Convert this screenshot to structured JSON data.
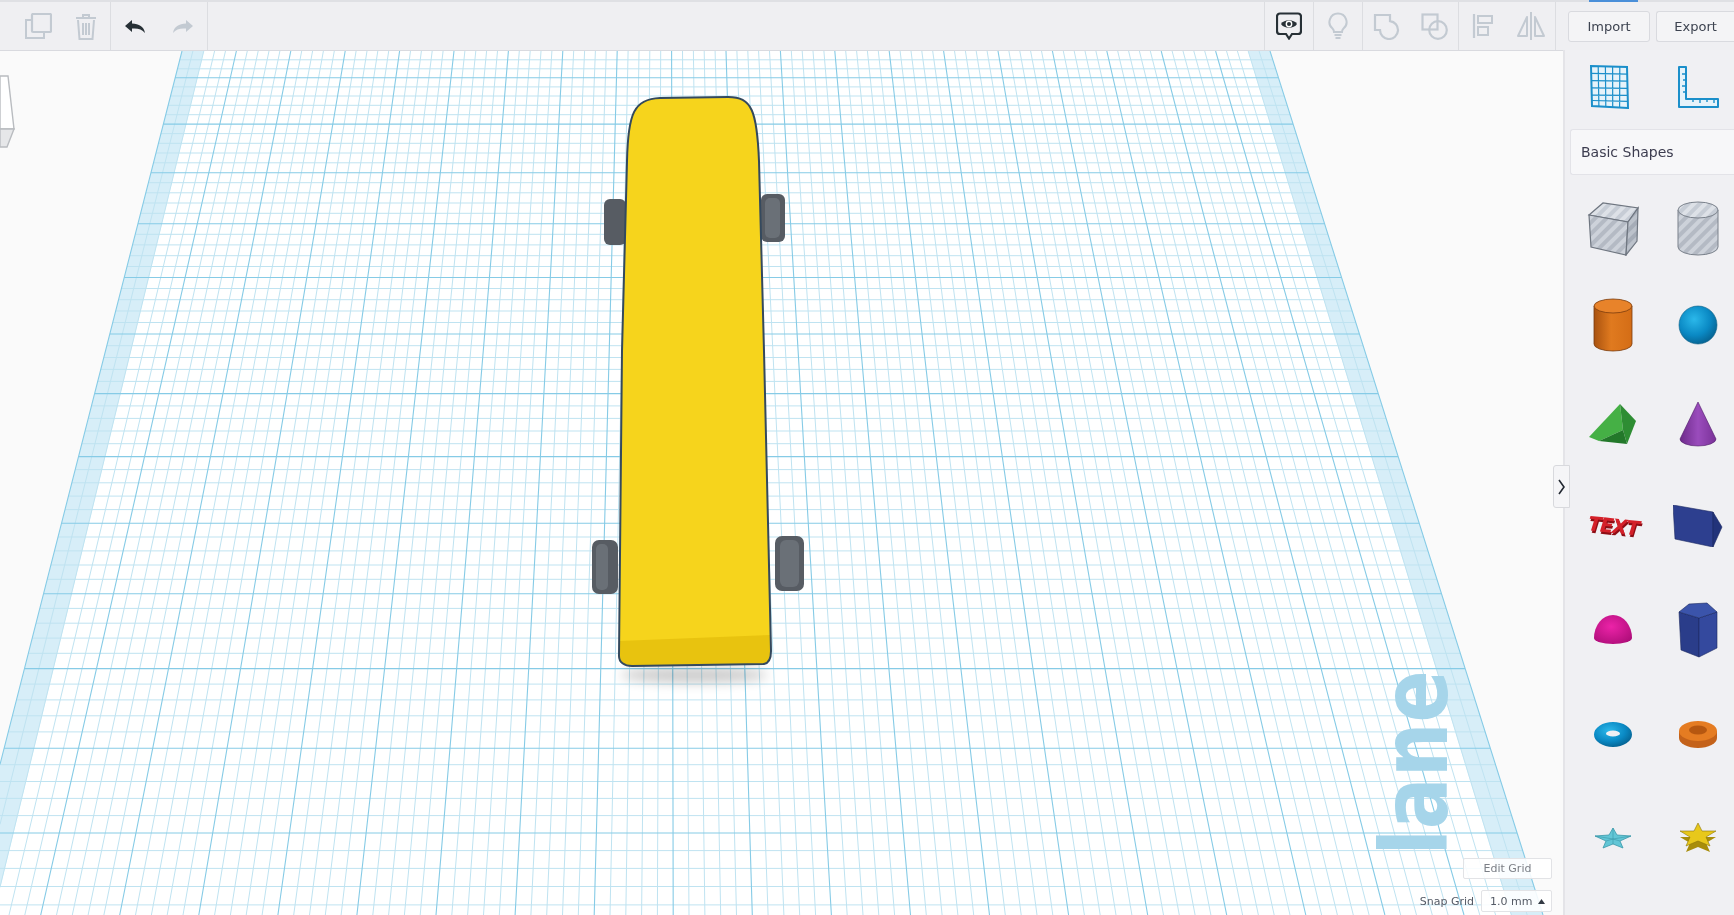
{
  "toolbar": {
    "left_groups": [
      {
        "tools": [
          {
            "kind": "duplicate",
            "disabled": true
          },
          {
            "kind": "delete",
            "disabled": true
          }
        ]
      },
      {
        "tools": [
          {
            "kind": "undo",
            "disabled": false
          },
          {
            "kind": "redo",
            "disabled": true
          }
        ]
      }
    ],
    "right_groups": [
      {
        "tools": [
          {
            "kind": "notes",
            "disabled": false
          }
        ]
      },
      {
        "tools": [
          {
            "kind": "hint",
            "disabled": true
          }
        ]
      },
      {
        "tools": [
          {
            "kind": "group",
            "disabled": true
          },
          {
            "kind": "hole",
            "disabled": true
          }
        ]
      },
      {
        "tools": [
          {
            "kind": "align",
            "disabled": true
          },
          {
            "kind": "mirror",
            "disabled": true
          }
        ]
      }
    ],
    "buttons": [
      {
        "label": "Import"
      },
      {
        "label": "Export"
      }
    ]
  },
  "workplane": {
    "label": "lane",
    "edit_grid_button": "Edit Grid",
    "snap_grid": {
      "label": "Snap Grid",
      "value": "1.0 mm"
    }
  },
  "panel": {
    "view_tools": [
      {
        "kind": "workplane_grid"
      },
      {
        "kind": "ruler"
      }
    ],
    "category": "Basic Shapes",
    "shapes": [
      {
        "kind": "box_hole"
      },
      {
        "kind": "cylinder_hole"
      },
      {
        "kind": "cylinder"
      },
      {
        "kind": "sphere"
      },
      {
        "kind": "roof"
      },
      {
        "kind": "cone"
      },
      {
        "kind": "text",
        "label": "TEXT"
      },
      {
        "kind": "wedge"
      },
      {
        "kind": "half_sphere"
      },
      {
        "kind": "polygon"
      },
      {
        "kind": "torus"
      },
      {
        "kind": "tube"
      },
      {
        "kind": "star"
      },
      {
        "kind": "star_solid"
      }
    ]
  }
}
